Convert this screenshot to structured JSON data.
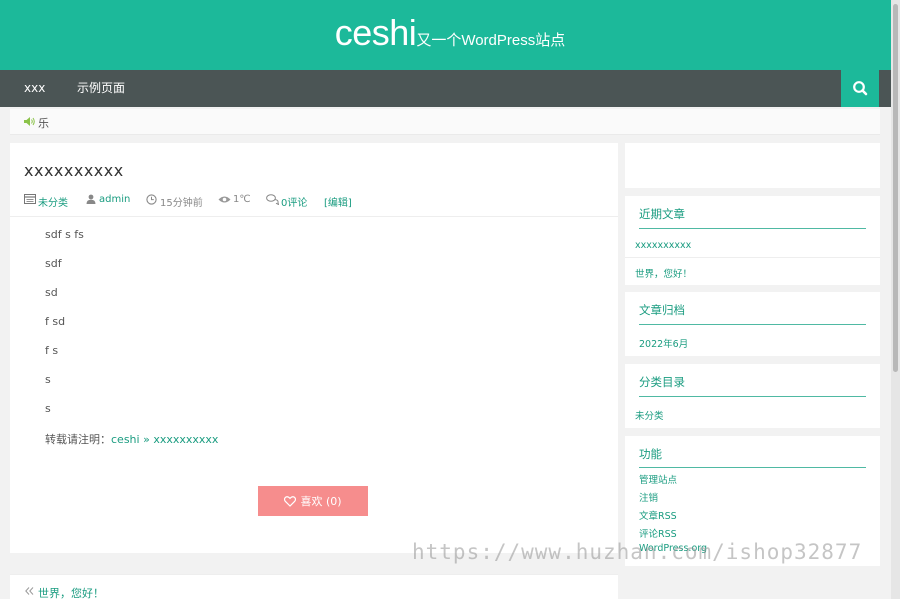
{
  "header": {
    "site_title": "ceshi",
    "site_description": "又一个WordPress站点"
  },
  "nav": {
    "items": [
      "xxx",
      "示例页面"
    ]
  },
  "notice": {
    "text": "乐"
  },
  "post": {
    "title": "xxxxxxxxxx",
    "meta": {
      "category": "未分类",
      "author": "admin",
      "time": "15分钟前",
      "views": "1℃",
      "comments": "0评论",
      "edit": "[编辑]"
    },
    "paragraphs": [
      "sdf s fs",
      "sdf",
      "sd",
      "f sd",
      "f s",
      "s",
      "s"
    ],
    "reprint_label": "转载请注明：",
    "reprint_site": "ceshi",
    "reprint_sep": " » ",
    "reprint_post": "xxxxxxxxxx",
    "like_label": "喜欢 (0)",
    "prev_post": "世界，您好！"
  },
  "sidebar": {
    "recent": {
      "title": "近期文章",
      "items": [
        "xxxxxxxxxx",
        "世界，您好！"
      ]
    },
    "archives": {
      "title": "文章归档",
      "items": [
        "2022年6月"
      ]
    },
    "categories": {
      "title": "分类目录",
      "items": [
        "未分类"
      ]
    },
    "meta": {
      "title": "功能",
      "items": [
        "管理站点",
        "注销",
        "文章RSS",
        "评论RSS",
        "WordPress.org"
      ]
    }
  },
  "watermark": "https://www.huzhan.com/ishop32877",
  "colors": {
    "brand": "#1cb99a",
    "nav_bg": "#4b5555",
    "link": "#1a9c80",
    "like_button": "#f68d8d"
  },
  "icons": [
    "search-icon",
    "speaker-icon",
    "category-icon",
    "user-icon",
    "clock-icon",
    "eye-icon",
    "comment-icon",
    "heart-icon",
    "double-chevron-left-icon"
  ]
}
